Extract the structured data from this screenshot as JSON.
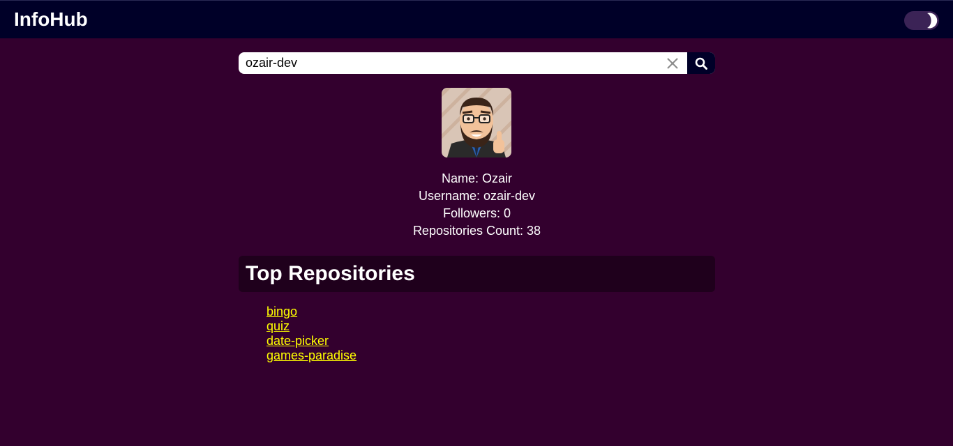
{
  "header": {
    "brand": "InfoHub",
    "theme_icon": "moon-icon"
  },
  "search": {
    "value": "ozair-dev",
    "clear_icon": "close-icon",
    "search_icon": "search-icon"
  },
  "profile": {
    "name": "Name: Ozair",
    "username": "Username: ozair-dev",
    "followers": "Followers: 0",
    "repo_count": "Repositories Count: 38"
  },
  "repos": {
    "title": "Top Repositories",
    "items": [
      {
        "label": "bingo"
      },
      {
        "label": "quiz"
      },
      {
        "label": "date-picker"
      },
      {
        "label": "games-paradise"
      }
    ]
  },
  "colors": {
    "page_bg": "#33002e",
    "header_bg": "#000028",
    "link": "#ffff00",
    "panel_bg": "#1f001c"
  }
}
